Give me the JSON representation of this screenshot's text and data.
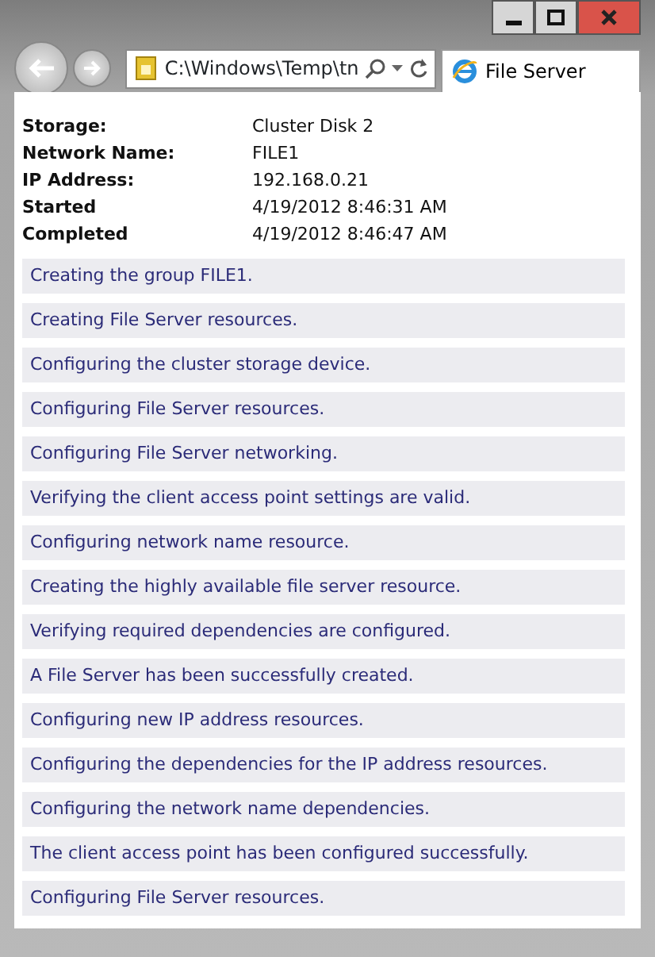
{
  "address_bar": {
    "value": "C:\\Windows\\Temp\\tn"
  },
  "tab": {
    "label": "File Server",
    "selected": true
  },
  "details": [
    {
      "label": "Storage:",
      "value": "Cluster Disk 2"
    },
    {
      "label": "Network Name:",
      "value": "FILE1"
    },
    {
      "label": "IP Address:",
      "value": "192.168.0.21"
    },
    {
      "label": "Started",
      "value": "4/19/2012 8:46:31 AM"
    },
    {
      "label": "Completed",
      "value": "4/19/2012 8:46:47 AM"
    }
  ],
  "log": [
    "Creating the group FILE1.",
    "Creating File Server resources.",
    "Configuring the cluster storage device.",
    "Configuring File Server resources.",
    "Configuring File Server networking.",
    "Verifying the client access point settings are valid.",
    "Configuring network name resource.",
    "Creating the highly available file server resource.",
    "Verifying required dependencies are configured.",
    "A File Server has been successfully created.",
    "Configuring new IP address resources.",
    "Configuring the dependencies for the IP address resources.",
    "Configuring the network name dependencies.",
    "The client access point has been configured successfully.",
    "Configuring File Server resources."
  ]
}
